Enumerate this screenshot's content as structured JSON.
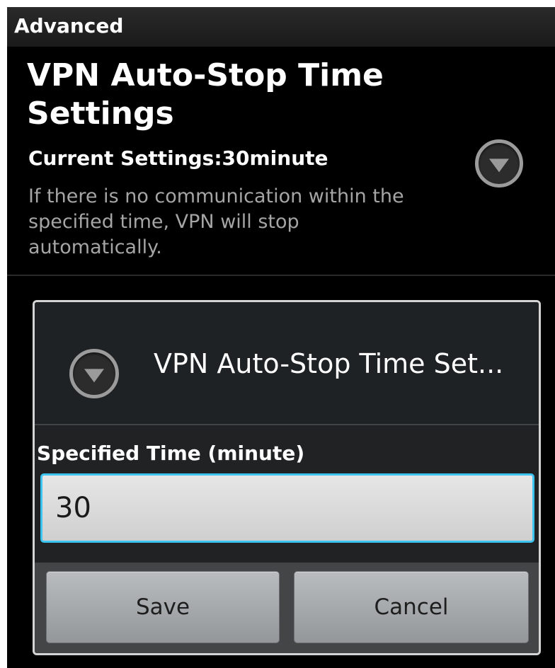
{
  "header": {
    "title": "Advanced"
  },
  "preference": {
    "title": "VPN Auto-Stop Time Settings",
    "current_settings": "Current Settings:30minute",
    "description": "If there is no communication within the specified time, VPN will stop automatically.",
    "icon": "dropdown-circle-icon"
  },
  "dialog": {
    "title": "VPN Auto-Stop Time Set...",
    "icon": "dropdown-circle-icon",
    "field_label": "Specified Time (minute)",
    "field_value": "30",
    "save_label": "Save",
    "cancel_label": "Cancel"
  },
  "colors": {
    "background": "#000000",
    "dialog_background": "#202224",
    "focus_accent": "#3ec4f0",
    "description_text": "#a5a5a5"
  }
}
